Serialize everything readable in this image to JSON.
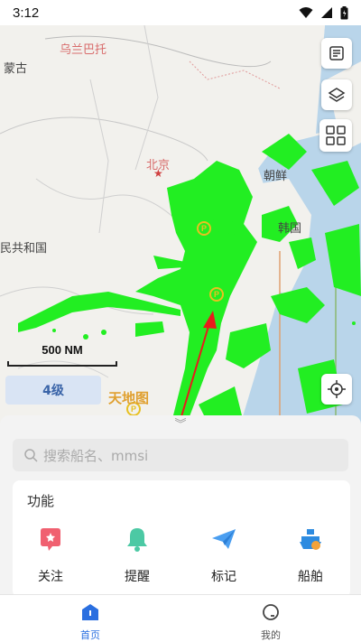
{
  "status_bar": {
    "time": "3:12"
  },
  "map": {
    "labels": {
      "wulanbatuo": "乌兰巴托",
      "menggu": "蒙古",
      "beijing": "北京",
      "chaoxian": "朝鲜",
      "hanguo": "韩国",
      "renmin_gongheguo": "民共和国",
      "tianjin": "天地图"
    },
    "scale_label": "500 NM",
    "zoom_level": "4级",
    "vessel_color": "#22ee22"
  },
  "controls": {
    "news": "news-icon",
    "layers": "layers-icon",
    "grid": "grid-icon",
    "locate": "locate-icon"
  },
  "sheet": {
    "search_placeholder": "搜索船名、mmsi",
    "section_title": "功能",
    "functions": [
      {
        "label": "关注",
        "icon": "star-heart-icon"
      },
      {
        "label": "提醒",
        "icon": "bell-icon"
      },
      {
        "label": "标记",
        "icon": "paper-plane-icon"
      },
      {
        "label": "船舶",
        "icon": "ship-icon"
      }
    ]
  },
  "bottom_nav": {
    "items": [
      {
        "label": "首页",
        "icon": "home-icon",
        "active": true
      },
      {
        "label": "我的",
        "icon": "profile-icon",
        "active": false
      }
    ]
  }
}
